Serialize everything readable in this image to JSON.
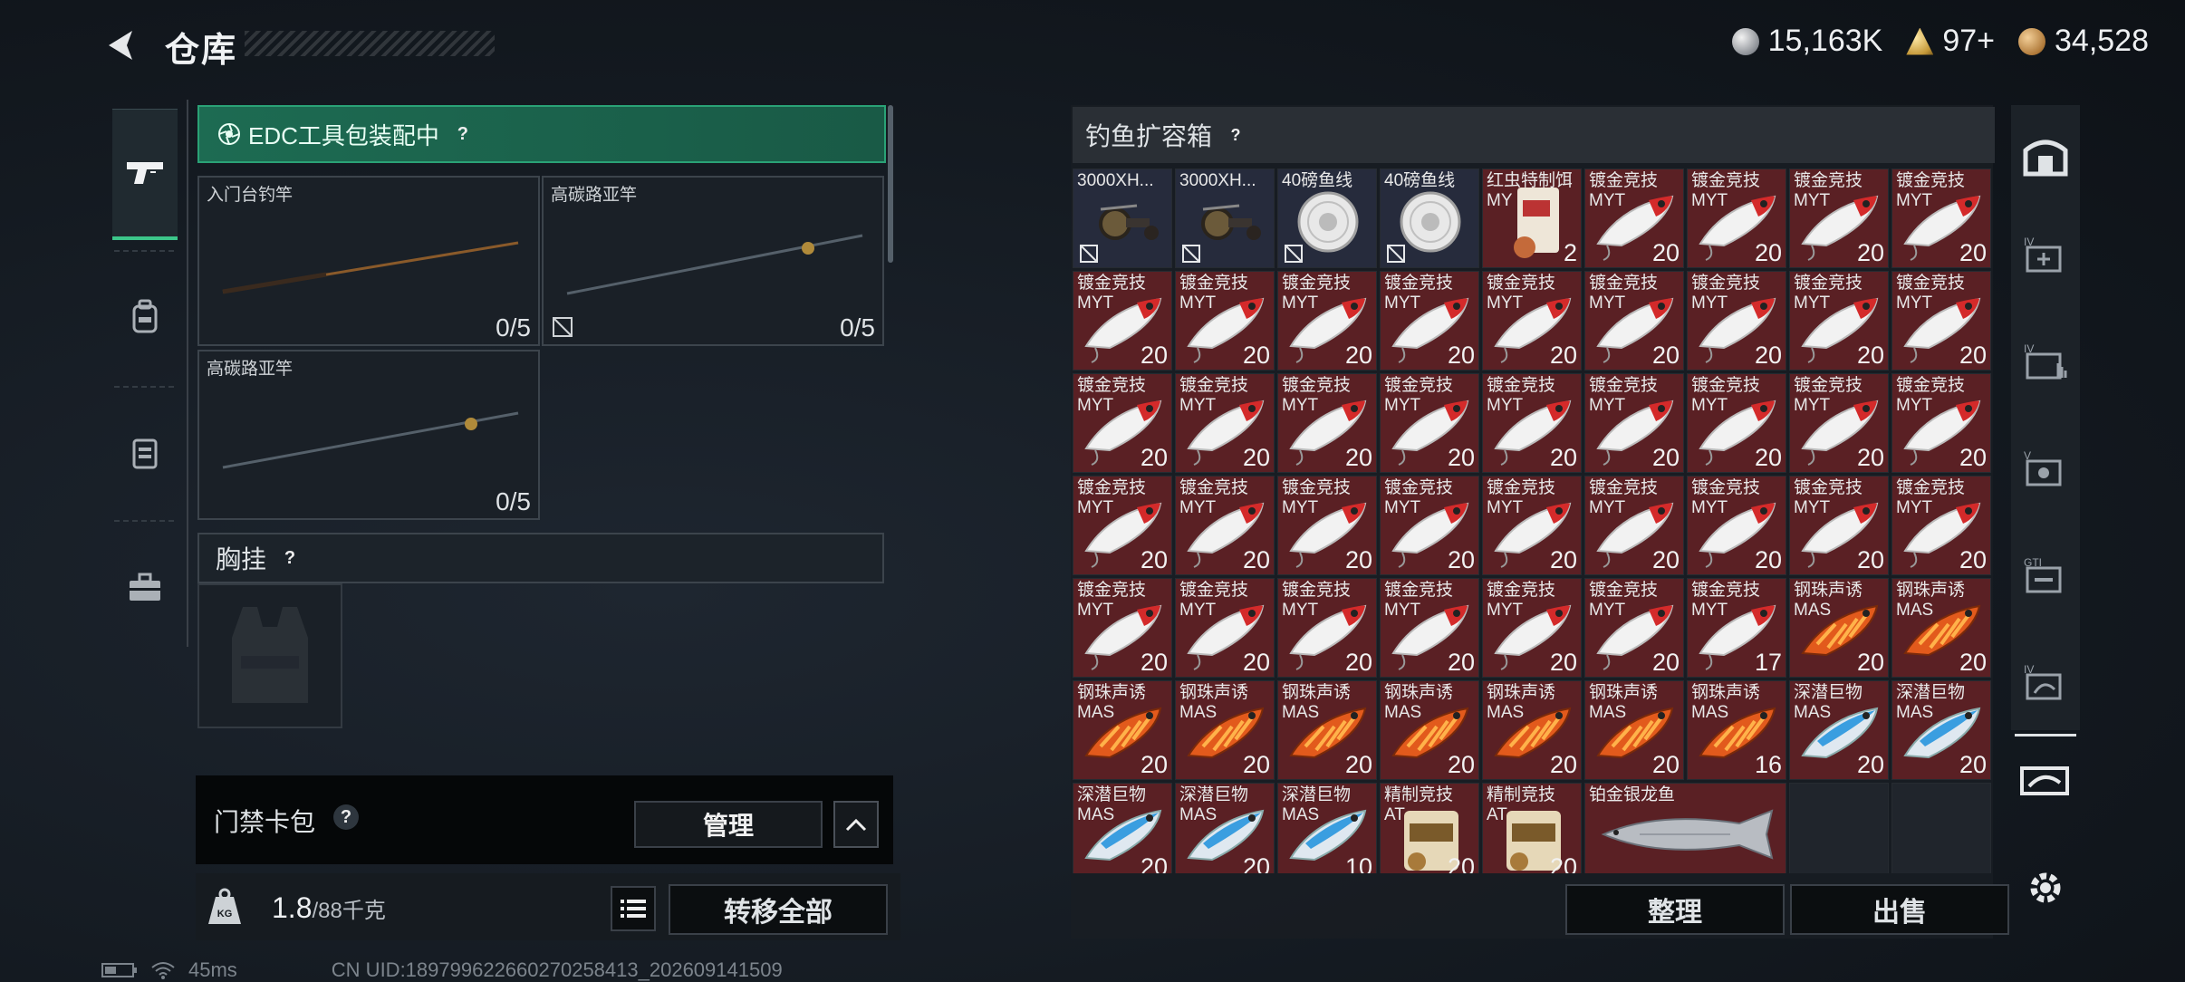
{
  "header": {
    "title": "仓库",
    "currencies": [
      {
        "icon": "silver-coin-icon",
        "value": "15,163K"
      },
      {
        "icon": "gold-ticket-icon",
        "value": "97+"
      },
      {
        "icon": "bronze-coin-icon",
        "value": "34,528"
      }
    ]
  },
  "left": {
    "edc_status": "EDC工具包装配中",
    "slots": [
      {
        "label": "入门台钓竿",
        "count": "0/5"
      },
      {
        "label": "高碳路亚竿",
        "count": "0/5"
      },
      {
        "label": "高碳路亚竿",
        "count": "0/5"
      }
    ],
    "chest_rig_label": "胸挂",
    "keycard_label": "门禁卡包",
    "manage_label": "管理",
    "weight_value": "1.8",
    "weight_max": "/88千克",
    "transfer_label": "转移全部"
  },
  "right": {
    "box_title": "钓鱼扩容箱",
    "sort_label": "整理",
    "sell_label": "出售",
    "items": [
      {
        "name": "3000XH...",
        "sub": "",
        "count": "",
        "type": "reel",
        "bg": "blue",
        "locked": true
      },
      {
        "name": "3000XH...",
        "sub": "",
        "count": "",
        "type": "reel",
        "bg": "blue",
        "locked": true
      },
      {
        "name": "40磅鱼线",
        "sub": "",
        "count": "",
        "type": "line",
        "bg": "blue",
        "locked": true
      },
      {
        "name": "40磅鱼线",
        "sub": "",
        "count": "",
        "type": "line",
        "bg": "blue",
        "locked": true
      },
      {
        "name": "红虫特制饵",
        "sub": "MY",
        "count": "2",
        "type": "bait",
        "bg": "red",
        "locked": false
      },
      {
        "name": "镀金竞技",
        "sub": "MYT",
        "count": "20",
        "type": "lure-red",
        "bg": "red",
        "locked": false
      },
      {
        "name": "镀金竞技",
        "sub": "MYT",
        "count": "20",
        "type": "lure-red",
        "bg": "red",
        "locked": false
      },
      {
        "name": "镀金竞技",
        "sub": "MYT",
        "count": "20",
        "type": "lure-red",
        "bg": "red",
        "locked": false
      },
      {
        "name": "镀金竞技",
        "sub": "MYT",
        "count": "20",
        "type": "lure-red",
        "bg": "red",
        "locked": false
      },
      {
        "name": "镀金竞技",
        "sub": "MYT",
        "count": "20",
        "type": "lure-red",
        "bg": "red",
        "locked": false
      },
      {
        "name": "镀金竞技",
        "sub": "MYT",
        "count": "20",
        "type": "lure-red",
        "bg": "red",
        "locked": false
      },
      {
        "name": "镀金竞技",
        "sub": "MYT",
        "count": "20",
        "type": "lure-red",
        "bg": "red",
        "locked": false
      },
      {
        "name": "镀金竞技",
        "sub": "MYT",
        "count": "20",
        "type": "lure-red",
        "bg": "red",
        "locked": false
      },
      {
        "name": "镀金竞技",
        "sub": "MYT",
        "count": "20",
        "type": "lure-red",
        "bg": "red",
        "locked": false
      },
      {
        "name": "镀金竞技",
        "sub": "MYT",
        "count": "20",
        "type": "lure-red",
        "bg": "red",
        "locked": false
      },
      {
        "name": "镀金竞技",
        "sub": "MYT",
        "count": "20",
        "type": "lure-red",
        "bg": "red",
        "locked": false
      },
      {
        "name": "镀金竞技",
        "sub": "MYT",
        "count": "20",
        "type": "lure-red",
        "bg": "red",
        "locked": false
      },
      {
        "name": "镀金竞技",
        "sub": "MYT",
        "count": "20",
        "type": "lure-red",
        "bg": "red",
        "locked": false
      },
      {
        "name": "镀金竞技",
        "sub": "MYT",
        "count": "20",
        "type": "lure-red",
        "bg": "red",
        "locked": false
      },
      {
        "name": "镀金竞技",
        "sub": "MYT",
        "count": "20",
        "type": "lure-red",
        "bg": "red",
        "locked": false
      },
      {
        "name": "镀金竞技",
        "sub": "MYT",
        "count": "20",
        "type": "lure-red",
        "bg": "red",
        "locked": false
      },
      {
        "name": "镀金竞技",
        "sub": "MYT",
        "count": "20",
        "type": "lure-red",
        "bg": "red",
        "locked": false
      },
      {
        "name": "镀金竞技",
        "sub": "MYT",
        "count": "20",
        "type": "lure-red",
        "bg": "red",
        "locked": false
      },
      {
        "name": "镀金竞技",
        "sub": "MYT",
        "count": "20",
        "type": "lure-red",
        "bg": "red",
        "locked": false
      },
      {
        "name": "镀金竞技",
        "sub": "MYT",
        "count": "20",
        "type": "lure-red",
        "bg": "red",
        "locked": false
      },
      {
        "name": "镀金竞技",
        "sub": "MYT",
        "count": "20",
        "type": "lure-red",
        "bg": "red",
        "locked": false
      },
      {
        "name": "镀金竞技",
        "sub": "MYT",
        "count": "20",
        "type": "lure-red",
        "bg": "red",
        "locked": false
      },
      {
        "name": "镀金竞技",
        "sub": "MYT",
        "count": "20",
        "type": "lure-red",
        "bg": "red",
        "locked": false
      },
      {
        "name": "镀金竞技",
        "sub": "MYT",
        "count": "20",
        "type": "lure-red",
        "bg": "red",
        "locked": false
      },
      {
        "name": "镀金竞技",
        "sub": "MYT",
        "count": "20",
        "type": "lure-red",
        "bg": "red",
        "locked": false
      },
      {
        "name": "镀金竞技",
        "sub": "MYT",
        "count": "20",
        "type": "lure-red",
        "bg": "red",
        "locked": false
      },
      {
        "name": "镀金竞技",
        "sub": "MYT",
        "count": "20",
        "type": "lure-red",
        "bg": "red",
        "locked": false
      },
      {
        "name": "镀金竞技",
        "sub": "MYT",
        "count": "20",
        "type": "lure-red",
        "bg": "red",
        "locked": false
      },
      {
        "name": "镀金竞技",
        "sub": "MYT",
        "count": "20",
        "type": "lure-red",
        "bg": "red",
        "locked": false
      },
      {
        "name": "镀金竞技",
        "sub": "MYT",
        "count": "20",
        "type": "lure-red",
        "bg": "red",
        "locked": false
      },
      {
        "name": "镀金竞技",
        "sub": "MYT",
        "count": "20",
        "type": "lure-red",
        "bg": "red",
        "locked": false
      },
      {
        "name": "镀金竞技",
        "sub": "MYT",
        "count": "20",
        "type": "lure-red",
        "bg": "red",
        "locked": false
      },
      {
        "name": "镀金竞技",
        "sub": "MYT",
        "count": "20",
        "type": "lure-red",
        "bg": "red",
        "locked": false
      },
      {
        "name": "镀金竞技",
        "sub": "MYT",
        "count": "20",
        "type": "lure-red",
        "bg": "red",
        "locked": false
      },
      {
        "name": "镀金竞技",
        "sub": "MYT",
        "count": "20",
        "type": "lure-red",
        "bg": "red",
        "locked": false
      },
      {
        "name": "镀金竞技",
        "sub": "MYT",
        "count": "20",
        "type": "lure-red",
        "bg": "red",
        "locked": false
      },
      {
        "name": "镀金竞技",
        "sub": "MYT",
        "count": "20",
        "type": "lure-red",
        "bg": "red",
        "locked": false
      },
      {
        "name": "镀金竞技",
        "sub": "MYT",
        "count": "17",
        "type": "lure-red",
        "bg": "red",
        "locked": false
      },
      {
        "name": "钢珠声诱",
        "sub": "MAS",
        "count": "20",
        "type": "lure-orange",
        "bg": "red",
        "locked": false
      },
      {
        "name": "钢珠声诱",
        "sub": "MAS",
        "count": "20",
        "type": "lure-orange",
        "bg": "red",
        "locked": false
      },
      {
        "name": "钢珠声诱",
        "sub": "MAS",
        "count": "20",
        "type": "lure-orange",
        "bg": "red",
        "locked": false
      },
      {
        "name": "钢珠声诱",
        "sub": "MAS",
        "count": "20",
        "type": "lure-orange",
        "bg": "red",
        "locked": false
      },
      {
        "name": "钢珠声诱",
        "sub": "MAS",
        "count": "20",
        "type": "lure-orange",
        "bg": "red",
        "locked": false
      },
      {
        "name": "钢珠声诱",
        "sub": "MAS",
        "count": "20",
        "type": "lure-orange",
        "bg": "red",
        "locked": false
      },
      {
        "name": "钢珠声诱",
        "sub": "MAS",
        "count": "20",
        "type": "lure-orange",
        "bg": "red",
        "locked": false
      },
      {
        "name": "钢珠声诱",
        "sub": "MAS",
        "count": "20",
        "type": "lure-orange",
        "bg": "red",
        "locked": false
      },
      {
        "name": "钢珠声诱",
        "sub": "MAS",
        "count": "16",
        "type": "lure-orange",
        "bg": "red",
        "locked": false
      },
      {
        "name": "深潜巨物",
        "sub": "MAS",
        "count": "20",
        "type": "lure-blue",
        "bg": "red",
        "locked": false
      },
      {
        "name": "深潜巨物",
        "sub": "MAS",
        "count": "20",
        "type": "lure-blue",
        "bg": "red",
        "locked": false
      },
      {
        "name": "深潜巨物",
        "sub": "MAS",
        "count": "20",
        "type": "lure-blue",
        "bg": "red",
        "locked": false
      },
      {
        "name": "深潜巨物",
        "sub": "MAS",
        "count": "20",
        "type": "lure-blue",
        "bg": "red",
        "locked": false
      },
      {
        "name": "深潜巨物",
        "sub": "MAS",
        "count": "10",
        "type": "lure-blue",
        "bg": "red",
        "locked": false
      },
      {
        "name": "精制竞技",
        "sub": "AT",
        "count": "20",
        "type": "bait-bag",
        "bg": "red",
        "locked": false
      },
      {
        "name": "精制竞技",
        "sub": "AT",
        "count": "20",
        "type": "bait-bag",
        "bg": "red",
        "locked": false
      },
      {
        "name": "铂金银龙鱼",
        "sub": "",
        "count": "",
        "type": "fish",
        "bg": "red",
        "locked": false,
        "wide": true
      }
    ]
  },
  "status": {
    "ping": "45ms",
    "uid": "CN UID:18979962266027025841​3_202609141509"
  }
}
